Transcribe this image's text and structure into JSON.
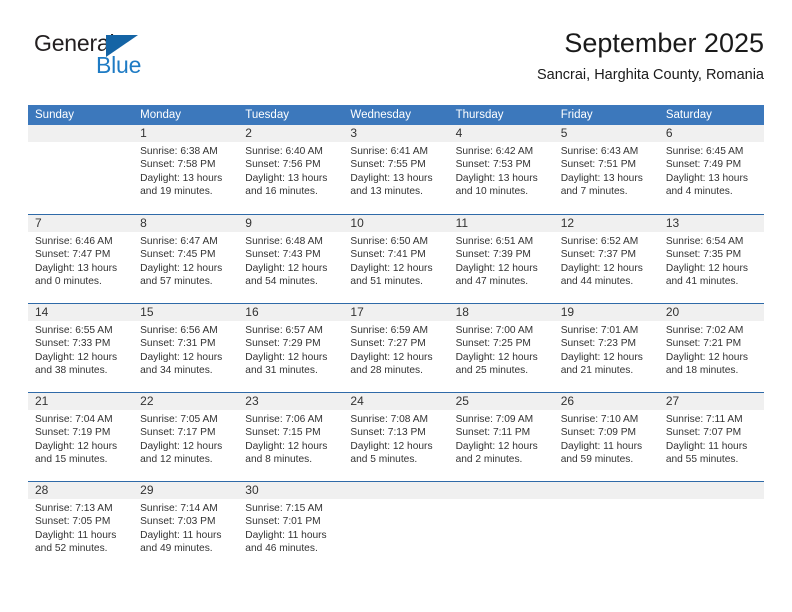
{
  "logo": {
    "word_top": "General",
    "word_bottom": "Blue",
    "triangle_icon": "triangle-icon",
    "brand_blue": "#1e7bc4",
    "brand_dark": "#231f20"
  },
  "header": {
    "title": "September 2025",
    "subtitle": "Sancrai, Harghita County, Romania"
  },
  "colors": {
    "header_row_bg": "#3c78bc",
    "day_band_bg": "#f0f0f0",
    "row_divider": "#2f6aa8",
    "text": "#333333"
  },
  "calendar": {
    "weekdays": [
      "Sunday",
      "Monday",
      "Tuesday",
      "Wednesday",
      "Thursday",
      "Friday",
      "Saturday"
    ],
    "weeks": [
      [
        {
          "day": "",
          "sunrise": "",
          "sunset": "",
          "daylight_line1": "",
          "daylight_line2": "",
          "empty": true
        },
        {
          "day": "1",
          "sunrise": "Sunrise: 6:38 AM",
          "sunset": "Sunset: 7:58 PM",
          "daylight_line1": "Daylight: 13 hours",
          "daylight_line2": "and 19 minutes."
        },
        {
          "day": "2",
          "sunrise": "Sunrise: 6:40 AM",
          "sunset": "Sunset: 7:56 PM",
          "daylight_line1": "Daylight: 13 hours",
          "daylight_line2": "and 16 minutes."
        },
        {
          "day": "3",
          "sunrise": "Sunrise: 6:41 AM",
          "sunset": "Sunset: 7:55 PM",
          "daylight_line1": "Daylight: 13 hours",
          "daylight_line2": "and 13 minutes."
        },
        {
          "day": "4",
          "sunrise": "Sunrise: 6:42 AM",
          "sunset": "Sunset: 7:53 PM",
          "daylight_line1": "Daylight: 13 hours",
          "daylight_line2": "and 10 minutes."
        },
        {
          "day": "5",
          "sunrise": "Sunrise: 6:43 AM",
          "sunset": "Sunset: 7:51 PM",
          "daylight_line1": "Daylight: 13 hours",
          "daylight_line2": "and 7 minutes."
        },
        {
          "day": "6",
          "sunrise": "Sunrise: 6:45 AM",
          "sunset": "Sunset: 7:49 PM",
          "daylight_line1": "Daylight: 13 hours",
          "daylight_line2": "and 4 minutes."
        }
      ],
      [
        {
          "day": "7",
          "sunrise": "Sunrise: 6:46 AM",
          "sunset": "Sunset: 7:47 PM",
          "daylight_line1": "Daylight: 13 hours",
          "daylight_line2": "and 0 minutes."
        },
        {
          "day": "8",
          "sunrise": "Sunrise: 6:47 AM",
          "sunset": "Sunset: 7:45 PM",
          "daylight_line1": "Daylight: 12 hours",
          "daylight_line2": "and 57 minutes."
        },
        {
          "day": "9",
          "sunrise": "Sunrise: 6:48 AM",
          "sunset": "Sunset: 7:43 PM",
          "daylight_line1": "Daylight: 12 hours",
          "daylight_line2": "and 54 minutes."
        },
        {
          "day": "10",
          "sunrise": "Sunrise: 6:50 AM",
          "sunset": "Sunset: 7:41 PM",
          "daylight_line1": "Daylight: 12 hours",
          "daylight_line2": "and 51 minutes."
        },
        {
          "day": "11",
          "sunrise": "Sunrise: 6:51 AM",
          "sunset": "Sunset: 7:39 PM",
          "daylight_line1": "Daylight: 12 hours",
          "daylight_line2": "and 47 minutes."
        },
        {
          "day": "12",
          "sunrise": "Sunrise: 6:52 AM",
          "sunset": "Sunset: 7:37 PM",
          "daylight_line1": "Daylight: 12 hours",
          "daylight_line2": "and 44 minutes."
        },
        {
          "day": "13",
          "sunrise": "Sunrise: 6:54 AM",
          "sunset": "Sunset: 7:35 PM",
          "daylight_line1": "Daylight: 12 hours",
          "daylight_line2": "and 41 minutes."
        }
      ],
      [
        {
          "day": "14",
          "sunrise": "Sunrise: 6:55 AM",
          "sunset": "Sunset: 7:33 PM",
          "daylight_line1": "Daylight: 12 hours",
          "daylight_line2": "and 38 minutes."
        },
        {
          "day": "15",
          "sunrise": "Sunrise: 6:56 AM",
          "sunset": "Sunset: 7:31 PM",
          "daylight_line1": "Daylight: 12 hours",
          "daylight_line2": "and 34 minutes."
        },
        {
          "day": "16",
          "sunrise": "Sunrise: 6:57 AM",
          "sunset": "Sunset: 7:29 PM",
          "daylight_line1": "Daylight: 12 hours",
          "daylight_line2": "and 31 minutes."
        },
        {
          "day": "17",
          "sunrise": "Sunrise: 6:59 AM",
          "sunset": "Sunset: 7:27 PM",
          "daylight_line1": "Daylight: 12 hours",
          "daylight_line2": "and 28 minutes."
        },
        {
          "day": "18",
          "sunrise": "Sunrise: 7:00 AM",
          "sunset": "Sunset: 7:25 PM",
          "daylight_line1": "Daylight: 12 hours",
          "daylight_line2": "and 25 minutes."
        },
        {
          "day": "19",
          "sunrise": "Sunrise: 7:01 AM",
          "sunset": "Sunset: 7:23 PM",
          "daylight_line1": "Daylight: 12 hours",
          "daylight_line2": "and 21 minutes."
        },
        {
          "day": "20",
          "sunrise": "Sunrise: 7:02 AM",
          "sunset": "Sunset: 7:21 PM",
          "daylight_line1": "Daylight: 12 hours",
          "daylight_line2": "and 18 minutes."
        }
      ],
      [
        {
          "day": "21",
          "sunrise": "Sunrise: 7:04 AM",
          "sunset": "Sunset: 7:19 PM",
          "daylight_line1": "Daylight: 12 hours",
          "daylight_line2": "and 15 minutes."
        },
        {
          "day": "22",
          "sunrise": "Sunrise: 7:05 AM",
          "sunset": "Sunset: 7:17 PM",
          "daylight_line1": "Daylight: 12 hours",
          "daylight_line2": "and 12 minutes."
        },
        {
          "day": "23",
          "sunrise": "Sunrise: 7:06 AM",
          "sunset": "Sunset: 7:15 PM",
          "daylight_line1": "Daylight: 12 hours",
          "daylight_line2": "and 8 minutes."
        },
        {
          "day": "24",
          "sunrise": "Sunrise: 7:08 AM",
          "sunset": "Sunset: 7:13 PM",
          "daylight_line1": "Daylight: 12 hours",
          "daylight_line2": "and 5 minutes."
        },
        {
          "day": "25",
          "sunrise": "Sunrise: 7:09 AM",
          "sunset": "Sunset: 7:11 PM",
          "daylight_line1": "Daylight: 12 hours",
          "daylight_line2": "and 2 minutes."
        },
        {
          "day": "26",
          "sunrise": "Sunrise: 7:10 AM",
          "sunset": "Sunset: 7:09 PM",
          "daylight_line1": "Daylight: 11 hours",
          "daylight_line2": "and 59 minutes."
        },
        {
          "day": "27",
          "sunrise": "Sunrise: 7:11 AM",
          "sunset": "Sunset: 7:07 PM",
          "daylight_line1": "Daylight: 11 hours",
          "daylight_line2": "and 55 minutes."
        }
      ],
      [
        {
          "day": "28",
          "sunrise": "Sunrise: 7:13 AM",
          "sunset": "Sunset: 7:05 PM",
          "daylight_line1": "Daylight: 11 hours",
          "daylight_line2": "and 52 minutes."
        },
        {
          "day": "29",
          "sunrise": "Sunrise: 7:14 AM",
          "sunset": "Sunset: 7:03 PM",
          "daylight_line1": "Daylight: 11 hours",
          "daylight_line2": "and 49 minutes."
        },
        {
          "day": "30",
          "sunrise": "Sunrise: 7:15 AM",
          "sunset": "Sunset: 7:01 PM",
          "daylight_line1": "Daylight: 11 hours",
          "daylight_line2": "and 46 minutes."
        },
        {
          "day": "",
          "sunrise": "",
          "sunset": "",
          "daylight_line1": "",
          "daylight_line2": "",
          "empty": true
        },
        {
          "day": "",
          "sunrise": "",
          "sunset": "",
          "daylight_line1": "",
          "daylight_line2": "",
          "empty": true
        },
        {
          "day": "",
          "sunrise": "",
          "sunset": "",
          "daylight_line1": "",
          "daylight_line2": "",
          "empty": true
        },
        {
          "day": "",
          "sunrise": "",
          "sunset": "",
          "daylight_line1": "",
          "daylight_line2": "",
          "empty": true
        }
      ]
    ]
  }
}
